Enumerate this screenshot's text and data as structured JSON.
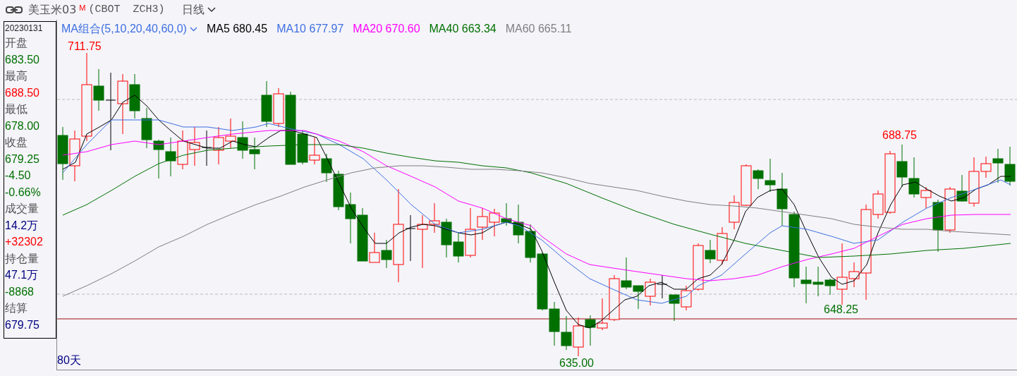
{
  "header": {
    "title": "美玉米03",
    "badge": "M",
    "code": "(CBOT  ZCH3)",
    "period": "日线"
  },
  "info_panel": {
    "date": "20230131",
    "rows": [
      {
        "text": "开盘",
        "color": "#555555"
      },
      {
        "text": "683.50",
        "color": "#007000"
      },
      {
        "text": "最高",
        "color": "#555555"
      },
      {
        "text": "688.50",
        "color": "#ff0000"
      },
      {
        "text": "最低",
        "color": "#555555"
      },
      {
        "text": "678.00",
        "color": "#007000"
      },
      {
        "text": "收盘",
        "color": "#555555"
      },
      {
        "text": "679.25",
        "color": "#007000"
      },
      {
        "text": "-4.50",
        "color": "#007000"
      },
      {
        "text": "-0.66%",
        "color": "#007000"
      },
      {
        "text": "成交量",
        "color": "#555555"
      },
      {
        "text": "14.2万",
        "color": "#000080"
      },
      {
        "text": "+32302",
        "color": "#ff0000"
      },
      {
        "text": "持仓量",
        "color": "#555555"
      },
      {
        "text": "47.1万",
        "color": "#000080"
      },
      {
        "text": "-8868",
        "color": "#007000"
      },
      {
        "text": "结算",
        "color": "#555555"
      },
      {
        "text": "679.75",
        "color": "#000080"
      }
    ]
  },
  "chart": {
    "ma_selector": "MA组合(5,10,20,40,60,0)",
    "legend": [
      {
        "text": "MA5 680.45",
        "color": "#000000"
      },
      {
        "text": "MA10 677.97",
        "color": "#3f6fe0"
      },
      {
        "text": "MA20 670.60",
        "color": "#ff00ff"
      },
      {
        "text": "MA40 663.34",
        "color": "#007000"
      },
      {
        "text": "MA60 665.11",
        "color": "#808080"
      }
    ],
    "price_labels": [
      {
        "text": "711.75",
        "kind": "high"
      },
      {
        "text": "635.00",
        "kind": "low"
      },
      {
        "text": "688.75",
        "kind": "high"
      },
      {
        "text": "648.25",
        "kind": "low"
      }
    ],
    "range": "80天"
  }
}
